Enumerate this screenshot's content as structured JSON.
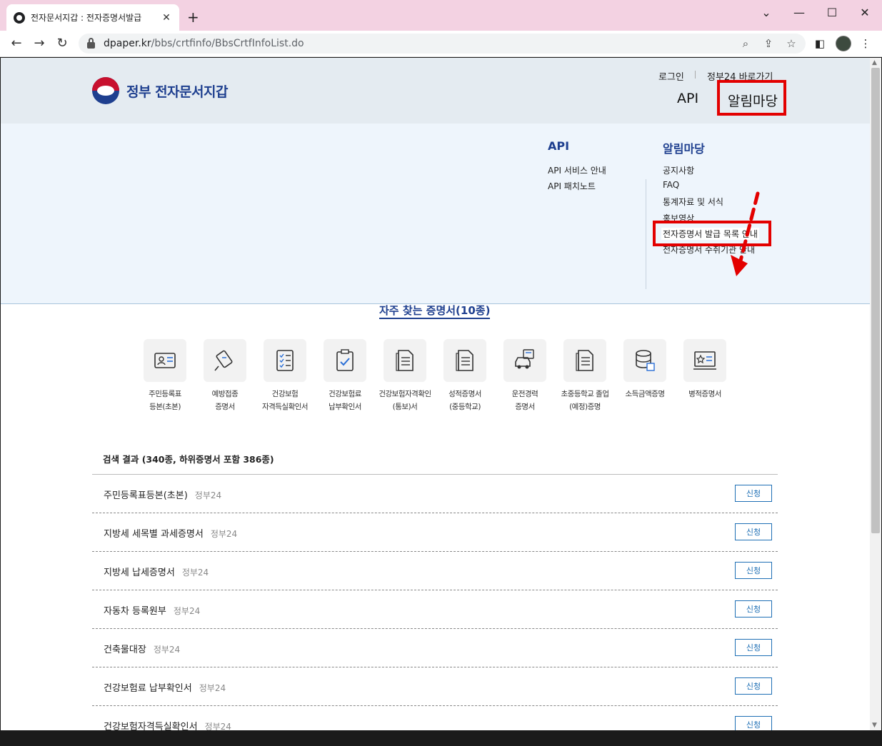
{
  "browser": {
    "tab_title": "전자문서지갑 : 전자증명서발급",
    "url_host": "dpaper.kr",
    "url_path": "/bbs/crtfinfo/BbsCrtfInfoList.do",
    "icons": [
      "back-icon",
      "forward-icon",
      "reload-icon",
      "lock-icon",
      "zoom-icon",
      "share-icon",
      "star-icon",
      "sidepanel-icon",
      "menu-icon"
    ]
  },
  "header": {
    "logo_text": "정부 전자문서지갑",
    "util_login": "로그인",
    "util_gov24": "정부24 바로가기",
    "nav_api": "API",
    "nav_notice": "알림마당"
  },
  "mega_menu": {
    "api": {
      "title": "API",
      "items": [
        "API 서비스 안내",
        "API 패치노트"
      ]
    },
    "notice": {
      "title": "알림마당",
      "items": [
        "공지사항",
        "FAQ",
        "통계자료 및 서식",
        "홍보영상",
        "전자증명서 발급 목록 안내",
        "전자증명서 수취기관 안내"
      ]
    }
  },
  "favorites": {
    "title": "자주 찾는 증명서(10종)",
    "items": [
      {
        "label": "주민등록표\n등본(초본)",
        "icon": "id-card-icon"
      },
      {
        "label": "예방접종\n증명서",
        "icon": "syringe-icon"
      },
      {
        "label": "건강보험\n자격득실확인서",
        "icon": "checklist-icon"
      },
      {
        "label": "건강보험료\n납부확인서",
        "icon": "clipboard-check-icon"
      },
      {
        "label": "건강보험자격확인\n(통보)서",
        "icon": "document-icon"
      },
      {
        "label": "성적증명서\n(중등학교)",
        "icon": "document-icon"
      },
      {
        "label": "운전경력\n증명서",
        "icon": "car-icon"
      },
      {
        "label": "초중등학교 졸업\n(예정)증명",
        "icon": "document-icon"
      },
      {
        "label": "소득금액증명",
        "icon": "coins-icon"
      },
      {
        "label": "병적증명서",
        "icon": "monitor-star-icon"
      }
    ]
  },
  "results": {
    "summary": "검색 결과 (340종, 하위증명서 포함 386종)",
    "apply_label": "신청",
    "rows": [
      {
        "name": "주민등록표등본(초본)",
        "agency": "정부24"
      },
      {
        "name": "지방세 세목별 과세증명서",
        "agency": "정부24"
      },
      {
        "name": "지방세 납세증명서",
        "agency": "정부24"
      },
      {
        "name": "자동차 등록원부",
        "agency": "정부24"
      },
      {
        "name": "건축물대장",
        "agency": "정부24"
      },
      {
        "name": "건강보험료 납부확인서",
        "agency": "정부24"
      },
      {
        "name": "건강보험자격득실확인서",
        "agency": "정부24"
      }
    ]
  },
  "colors": {
    "brand_blue": "#1e3f8f",
    "highlight_red": "#e30000",
    "header_bg": "#e4ebf1",
    "mega_bg": "#eef5fc"
  }
}
